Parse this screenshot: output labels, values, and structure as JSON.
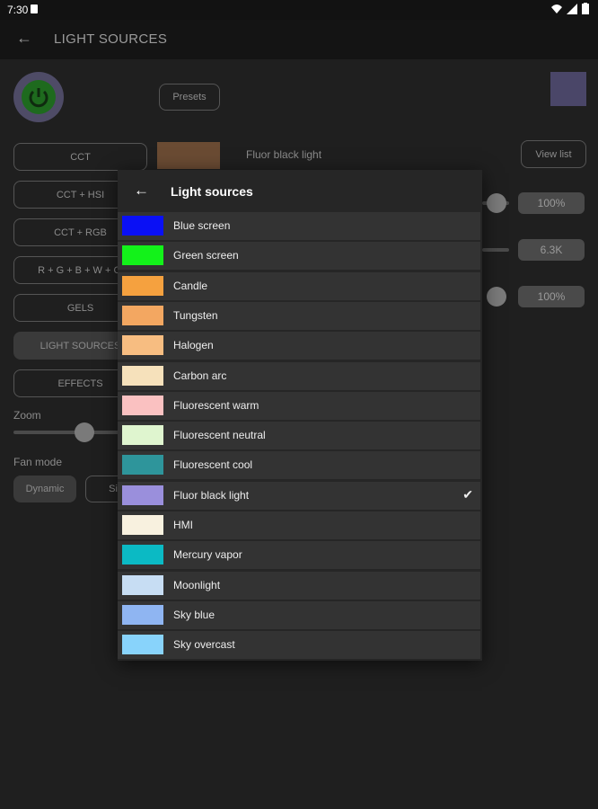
{
  "status_bar": {
    "time": "7:30"
  },
  "app_bar": {
    "back": "←",
    "title": "LIGHT SOURCES"
  },
  "background": {
    "presets_label": "Presets",
    "current_source": "Fluor black light",
    "view_list_label": "View list",
    "modes": [
      "CCT",
      "CCT + HSI",
      "CCT + RGB",
      "R + G + B + W + Cl",
      "GELS",
      "LIGHT SOURCES",
      "EFFECTS"
    ],
    "zoom_label": "Zoom",
    "fan_mode_label": "Fan mode",
    "fan_dynamic": "Dynamic",
    "fan_other": "Si",
    "values": [
      "100%",
      "6.3K",
      "100%"
    ],
    "preview_color": "#4a4668"
  },
  "dialog": {
    "back": "←",
    "title": "Light sources",
    "selected": "Fluor black light",
    "items": [
      {
        "name": "Blue screen",
        "color": "#0a10f5"
      },
      {
        "name": "Green screen",
        "color": "#13f21a"
      },
      {
        "name": "Candle",
        "color": "#f5a13f"
      },
      {
        "name": "Tungsten",
        "color": "#f3a761"
      },
      {
        "name": "Halogen",
        "color": "#f7bd81"
      },
      {
        "name": "Carbon arc",
        "color": "#f6e1bb"
      },
      {
        "name": "Fluorescent warm",
        "color": "#fac1c1"
      },
      {
        "name": "Fluorescent neutral",
        "color": "#dff5cf"
      },
      {
        "name": "Fluorescent cool",
        "color": "#2e959b"
      },
      {
        "name": "Fluor black light",
        "color": "#9a8fdc",
        "checked": true
      },
      {
        "name": "HMI",
        "color": "#f8f1df"
      },
      {
        "name": "Mercury vapor",
        "color": "#0bbac4"
      },
      {
        "name": "Moonlight",
        "color": "#c7ddf3"
      },
      {
        "name": "Sky blue",
        "color": "#8fb5f2"
      },
      {
        "name": "Sky overcast",
        "color": "#88d3fb"
      }
    ]
  }
}
